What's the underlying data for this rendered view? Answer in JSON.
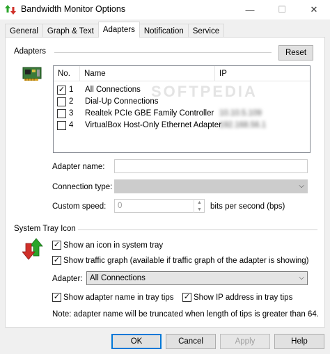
{
  "window": {
    "title": "Bandwidth Monitor Options",
    "min_glyph": "—",
    "max_glyph": "☐",
    "close_glyph": "✕"
  },
  "tabs": [
    {
      "label": "General",
      "active": false
    },
    {
      "label": "Graph & Text",
      "active": false
    },
    {
      "label": "Adapters",
      "active": true
    },
    {
      "label": "Notification",
      "active": false
    },
    {
      "label": "Service",
      "active": false
    }
  ],
  "adapters": {
    "group_label": "Adapters",
    "reset_label": "Reset",
    "columns": {
      "no": "No.",
      "name": "Name",
      "ip": "IP"
    },
    "rows": [
      {
        "checked": true,
        "no": "1",
        "name": "All Connections",
        "ip": ""
      },
      {
        "checked": false,
        "no": "2",
        "name": "Dial-Up Connections",
        "ip": ""
      },
      {
        "checked": false,
        "no": "3",
        "name": "Realtek PCIe GBE Family Controller",
        "ip": "10.10.5.109"
      },
      {
        "checked": false,
        "no": "4",
        "name": "VirtualBox Host-Only Ethernet Adapter",
        "ip": "192.168.56.1"
      }
    ],
    "adapter_name_label": "Adapter name:",
    "adapter_name_value": "",
    "connection_type_label": "Connection type:",
    "connection_type_value": "",
    "custom_speed_label": "Custom speed:",
    "custom_speed_value": "0",
    "speed_unit": "bits per second (bps)"
  },
  "tray": {
    "group_label": "System Tray Icon",
    "show_icon": {
      "checked": true,
      "label": "Show an icon in system tray"
    },
    "show_graph": {
      "checked": true,
      "label": "Show traffic graph (available if traffic graph of the adapter is showing)"
    },
    "adapter_label": "Adapter:",
    "adapter_value": "All Connections",
    "show_name": {
      "checked": true,
      "label": "Show adapter name in tray tips"
    },
    "show_ip": {
      "checked": true,
      "label": "Show IP address in tray tips"
    },
    "note": "Note: adapter name will be truncated when length of tips is greater than 64."
  },
  "buttons": {
    "ok": "OK",
    "cancel": "Cancel",
    "apply": "Apply",
    "help": "Help"
  },
  "watermark": "SOFTPEDIA",
  "colors": {
    "arrow_up": "#2aa52a",
    "arrow_down": "#d0302a",
    "accent": "#0078d7"
  }
}
